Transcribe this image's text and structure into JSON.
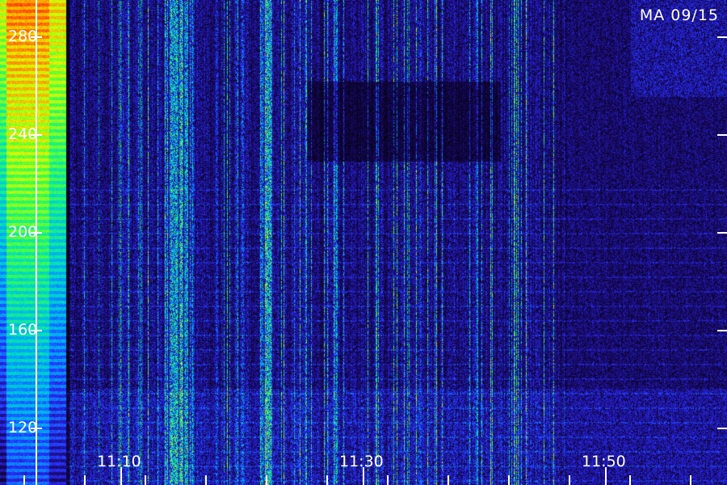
{
  "date_label": "MA 09/15",
  "chart_data": {
    "type": "heatmap",
    "title": "",
    "xlabel": "",
    "ylabel": "",
    "ylim": [
      110,
      265
    ],
    "xlim": [
      "11:02",
      "11:58"
    ],
    "y_ticks": [
      {
        "value": 280,
        "label": "280"
      },
      {
        "value": 240,
        "label": "240"
      },
      {
        "value": 200,
        "label": "200"
      },
      {
        "value": 160,
        "label": "160"
      },
      {
        "value": 120,
        "label": "120"
      }
    ],
    "x_ticks": [
      {
        "value": "11:10",
        "label": "11:10"
      },
      {
        "value": "11:30",
        "label": "11:30"
      },
      {
        "value": "11:50",
        "label": "11:50"
      }
    ],
    "colormap": [
      "#000000",
      "#1a0a6b",
      "#2a2aff",
      "#00a0ff",
      "#00e0c0",
      "#40ff40",
      "#e0ff00",
      "#ff9000",
      "#ff2000"
    ],
    "grid": false,
    "legend": "none"
  },
  "colors": {
    "background": "#000000",
    "axis": "#ffffff"
  }
}
